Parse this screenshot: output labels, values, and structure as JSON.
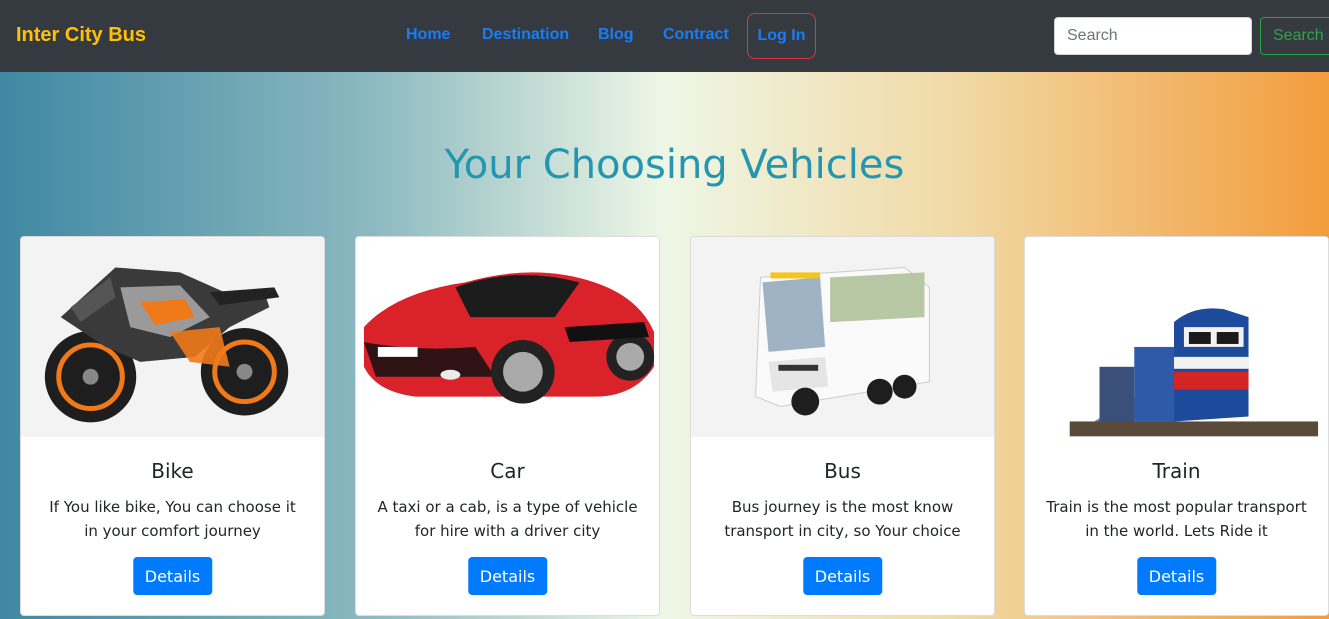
{
  "navbar": {
    "brand": "Inter City Bus",
    "links": [
      "Home",
      "Destination",
      "Blog",
      "Contract"
    ],
    "login_label": "Log In",
    "search_placeholder": "Search",
    "search_button": "Search"
  },
  "main": {
    "title": "Your Choosing Vehicles",
    "cards": [
      {
        "title": "Bike",
        "text": "If You like bike, You can choose it in your comfort journey",
        "button": "Details"
      },
      {
        "title": "Car",
        "text": "A taxi or a cab, is a type of vehicle for hire with a driver city",
        "button": "Details"
      },
      {
        "title": "Bus",
        "text": "Bus journey is the most know transport in city, so Your choice",
        "button": "Details"
      },
      {
        "title": "Train",
        "text": "Train is the most popular transport in the world. Lets Ride it",
        "button": "Details"
      }
    ]
  },
  "colors": {
    "navbar_bg": "#343a40",
    "brand": "#ffc107",
    "link": "#1a7cf5",
    "title": "#2596b0",
    "primary": "#007bff",
    "success": "#28a745",
    "danger": "#dc3545"
  }
}
